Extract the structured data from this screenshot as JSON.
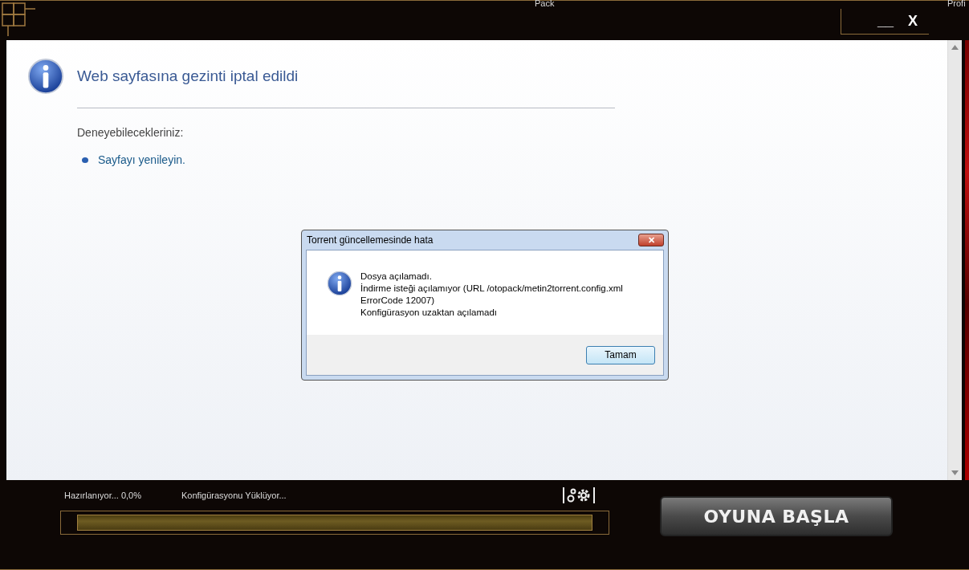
{
  "background_labels": [
    "Pack",
    "Profi"
  ],
  "window_controls": [
    "__",
    "X"
  ],
  "error_page": {
    "title": "Web sayfasına gezinti iptal edildi",
    "subtitle": "Deneyebilecekleriniz:",
    "suggestions": [
      "Sayfayı yenileyin."
    ]
  },
  "dialog": {
    "title": "Torrent güncellemesinde hata",
    "close": "✕",
    "lines": [
      "Dosya açılamadı.",
      "İndirme isteği açılamıyor (URL /otopack/metin2torrent.config.xml",
      "ErrorCode 12007)",
      "Konfigürasyon uzaktan açılamadı"
    ],
    "button": "Tamam"
  },
  "status": {
    "progress_text": "Hazırlanıyor... 0,0%",
    "task_text": "Konfigürasyonu Yüklüyor...",
    "level": 0
  },
  "start_button": "OYUNA BAŞLA"
}
